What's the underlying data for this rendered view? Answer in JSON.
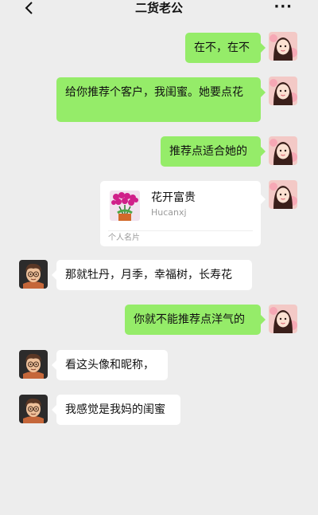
{
  "header": {
    "title": "二货老公",
    "back_icon": "chevron-left-icon",
    "more_label": "···"
  },
  "messages": [
    {
      "sender": "me",
      "text": "在不，在不"
    },
    {
      "sender": "me",
      "text": "给你推荐个客户，我闺蜜。她要点花"
    },
    {
      "sender": "me",
      "text": "推荐点适合她的"
    },
    {
      "sender": "me",
      "type": "contact-card",
      "name": "花开富贵",
      "id": "Hucanxj",
      "card_label": "个人名片"
    },
    {
      "sender": "other",
      "text": "那就牡丹，月季，幸福树，长寿花"
    },
    {
      "sender": "me",
      "text": "你就不能推荐点洋气的"
    },
    {
      "sender": "other",
      "text": "看这头像和昵称，"
    },
    {
      "sender": "other",
      "text": "我感觉是我妈的闺蜜"
    }
  ],
  "colors": {
    "background": "#ededed",
    "my_bubble": "#95ec69",
    "other_bubble": "#ffffff"
  }
}
